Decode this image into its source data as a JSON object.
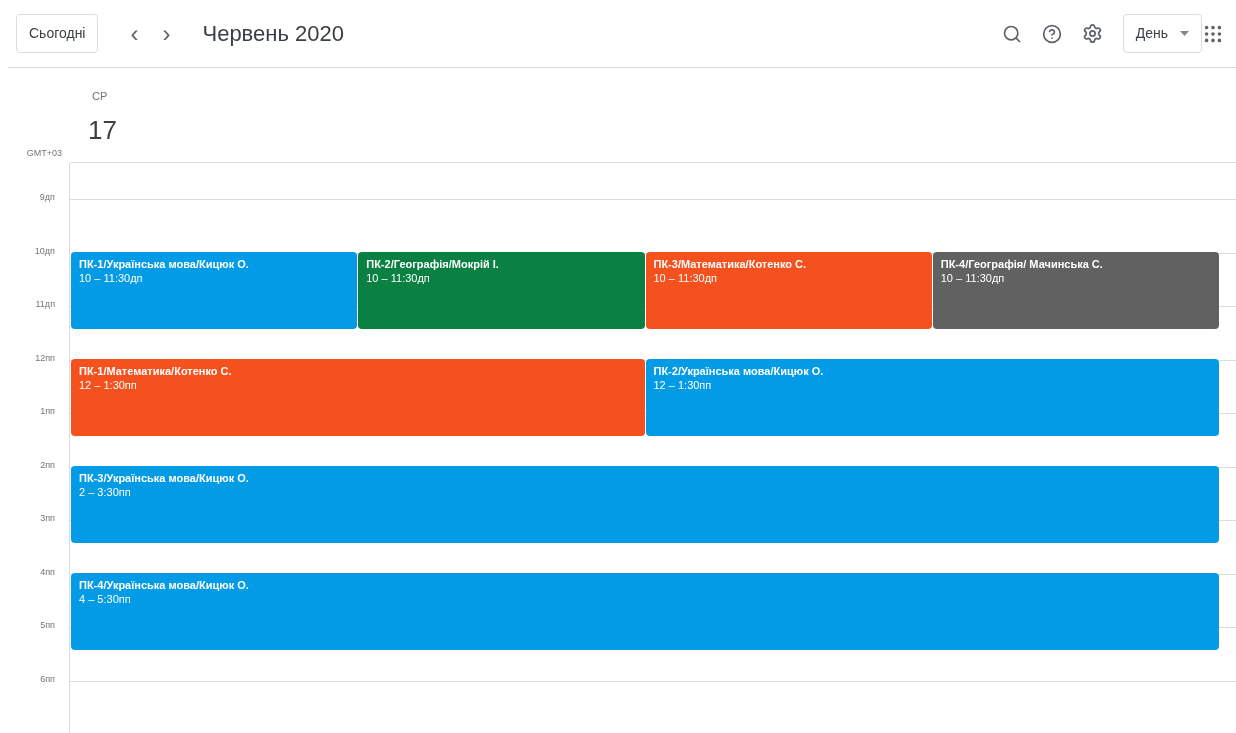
{
  "toolbar": {
    "today_button": "Сьогодні",
    "prev_button": "‹",
    "next_button": "›",
    "title": "Червень 2020",
    "view_select": "День"
  },
  "day": {
    "weekday": "СР",
    "date": "17"
  },
  "timezone": "GMT+03",
  "hours": [
    "9дп",
    "10дп",
    "11дп",
    "12пп",
    "1пп",
    "2пп",
    "3пп",
    "4пп",
    "5пп",
    "6пп"
  ],
  "event_groups": [
    {
      "events": [
        {
          "title": "ПК-1/Українська мова/Кицюк О.",
          "time": "10 – 11:30дп",
          "color": "#039be5"
        },
        {
          "title": "ПК-2/Географія/Мокрій І.",
          "time": "10 – 11:30дп",
          "color": "#0b8043"
        },
        {
          "title": "ПК-3/Математика/Котенко С.",
          "time": "10 – 11:30дп",
          "color": "#f4511e"
        },
        {
          "title": "ПК-4/Географія/ Мачинська С.",
          "time": "10 – 11:30дп",
          "color": "#616161"
        }
      ]
    },
    {
      "events": [
        {
          "title": "ПК-1/Математика/Котенко С.",
          "time": "12 – 1:30пп",
          "color": "#f4511e"
        },
        {
          "title": "ПК-2/Українська мова/Кицюк О.",
          "time": "12 – 1:30пп",
          "color": "#039be5"
        }
      ]
    },
    {
      "events": [
        {
          "title": "ПК-3/Українська мова/Кицюк О.",
          "time": "2 – 3:30пп",
          "color": "#039be5"
        }
      ]
    },
    {
      "events": [
        {
          "title": "ПК-4/Українська мова/Кицюк О.",
          "time": "4 – 5:30пп",
          "color": "#039be5"
        }
      ]
    }
  ]
}
